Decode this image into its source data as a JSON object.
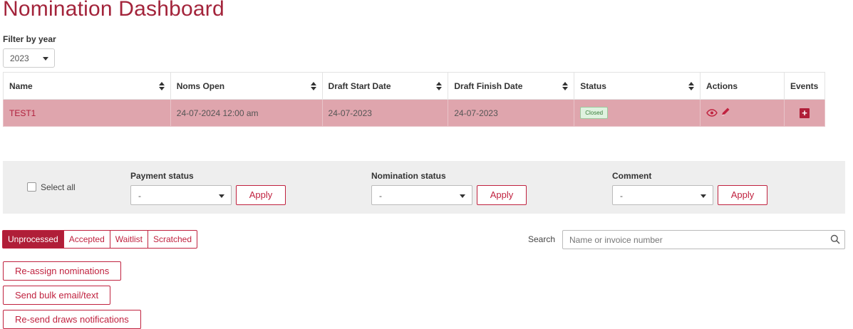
{
  "page": {
    "title": "Nomination Dashboard"
  },
  "filter": {
    "label": "Filter by year",
    "year": "2023"
  },
  "table": {
    "columns": [
      "Name",
      "Noms Open",
      "Draft Start Date",
      "Draft Finish Date",
      "Status",
      "Actions",
      "Events"
    ],
    "rows": [
      {
        "name": "TEST1",
        "noms_open": "24-07-2024 12:00 am",
        "draft_start": "24-07-2023",
        "draft_finish": "24-07-2023",
        "status": "Closed",
        "actions_icons": [
          "eye-icon",
          "pencil-icon"
        ],
        "events_icon": "plus-icon"
      }
    ]
  },
  "bulk": {
    "select_all": "Select all",
    "payment": {
      "label": "Payment status",
      "value": "-",
      "apply": "Apply"
    },
    "nomination": {
      "label": "Nomination status",
      "value": "-",
      "apply": "Apply"
    },
    "comment": {
      "label": "Comment",
      "value": "-",
      "apply": "Apply"
    }
  },
  "tabs": [
    {
      "label": "Unprocessed",
      "active": true
    },
    {
      "label": "Accepted",
      "active": false
    },
    {
      "label": "Waitlist",
      "active": false
    },
    {
      "label": "Scratched",
      "active": false
    }
  ],
  "search": {
    "label": "Search",
    "placeholder": "Name or invoice number"
  },
  "buttons": {
    "reassign": "Re-assign nominations",
    "bulk_email": "Send bulk email/text",
    "resend": "Re-send draws notifications"
  },
  "colors": {
    "accent": "#b01e38",
    "row_highlight": "#dfa5ad",
    "bar_bg": "#eeeeee"
  }
}
